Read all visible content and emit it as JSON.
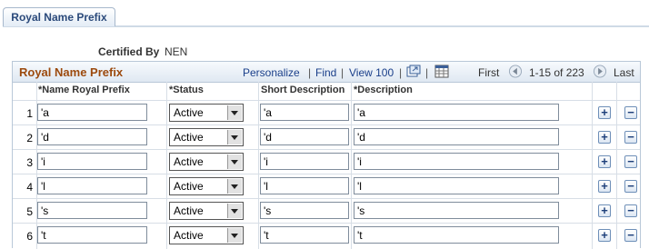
{
  "tab": {
    "label": "Royal Name Prefix"
  },
  "certified": {
    "label": "Certified By",
    "value": "NEN"
  },
  "grid": {
    "title": "Royal Name Prefix",
    "personalize": "Personalize",
    "find": "Find",
    "view": "View 100",
    "first": "First",
    "range": "1-15 of 223",
    "last": "Last",
    "columns": [
      "*Name Royal Prefix",
      "*Status",
      "Short Description",
      "*Description"
    ],
    "rows": [
      {
        "num": "1",
        "prefix": "'a",
        "status": "Active",
        "short": "'a",
        "desc": "'a"
      },
      {
        "num": "2",
        "prefix": "'d",
        "status": "Active",
        "short": "'d",
        "desc": "'d"
      },
      {
        "num": "3",
        "prefix": "'i",
        "status": "Active",
        "short": "'i",
        "desc": "'i"
      },
      {
        "num": "4",
        "prefix": "'l",
        "status": "Active",
        "short": "'l",
        "desc": "'l"
      },
      {
        "num": "5",
        "prefix": "'s",
        "status": "Active",
        "short": "'s",
        "desc": "'s"
      },
      {
        "num": "6",
        "prefix": "'t",
        "status": "Active",
        "short": "'t",
        "desc": "'t"
      }
    ]
  },
  "icons": {
    "zoom": "zoom-grid-icon",
    "download": "download-excel-icon",
    "prev": "previous-page-icon",
    "next": "next-page-icon",
    "add": "add-row-icon",
    "delete": "delete-row-icon"
  }
}
